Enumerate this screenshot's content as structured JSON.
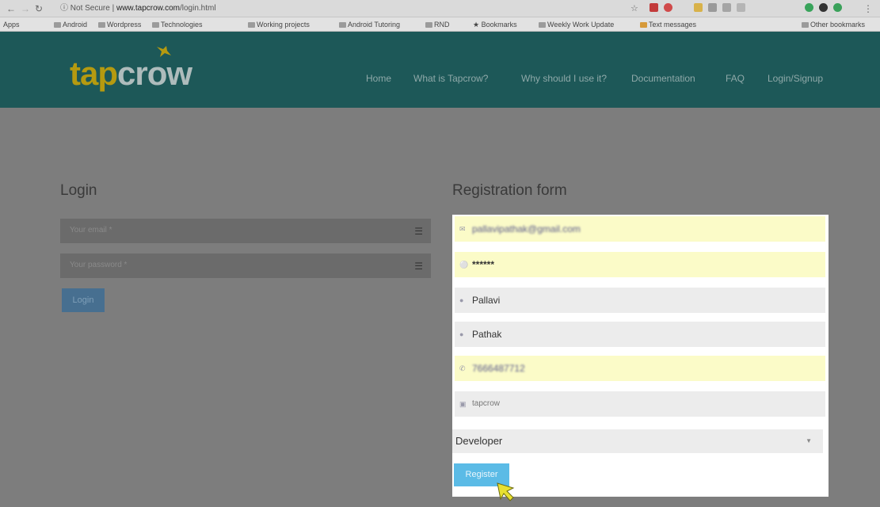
{
  "browser": {
    "address": "Not Secure",
    "host": "www.tapcrow.com",
    "path": "/login.html",
    "bookmarks_apps": "Apps",
    "bookmarks": [
      "Android",
      "Wordpress",
      "Technologies",
      "Working projects",
      "Android Tutoring",
      "RND",
      "Bookmarks",
      "Weekly Work Update",
      "Text messages"
    ],
    "other_bookmarks": "Other bookmarks"
  },
  "site": {
    "logo_part1": "tap",
    "logo_part2": "crow",
    "nav": [
      "Home",
      "What is Tapcrow?",
      "Why should I use it?",
      "Documentation",
      "FAQ",
      "Login/Signup"
    ]
  },
  "login": {
    "title": "Login",
    "email_placeholder": "Your email *",
    "password_placeholder": "Your password *",
    "button": "Login"
  },
  "registration": {
    "title": "Registration form",
    "email": "pallavipathak@gmail.com",
    "password": "******",
    "first_name": "Pallavi",
    "last_name": "Pathak",
    "phone": "7666487712",
    "company": "tapcrow",
    "role": "Developer",
    "button": "Register"
  }
}
